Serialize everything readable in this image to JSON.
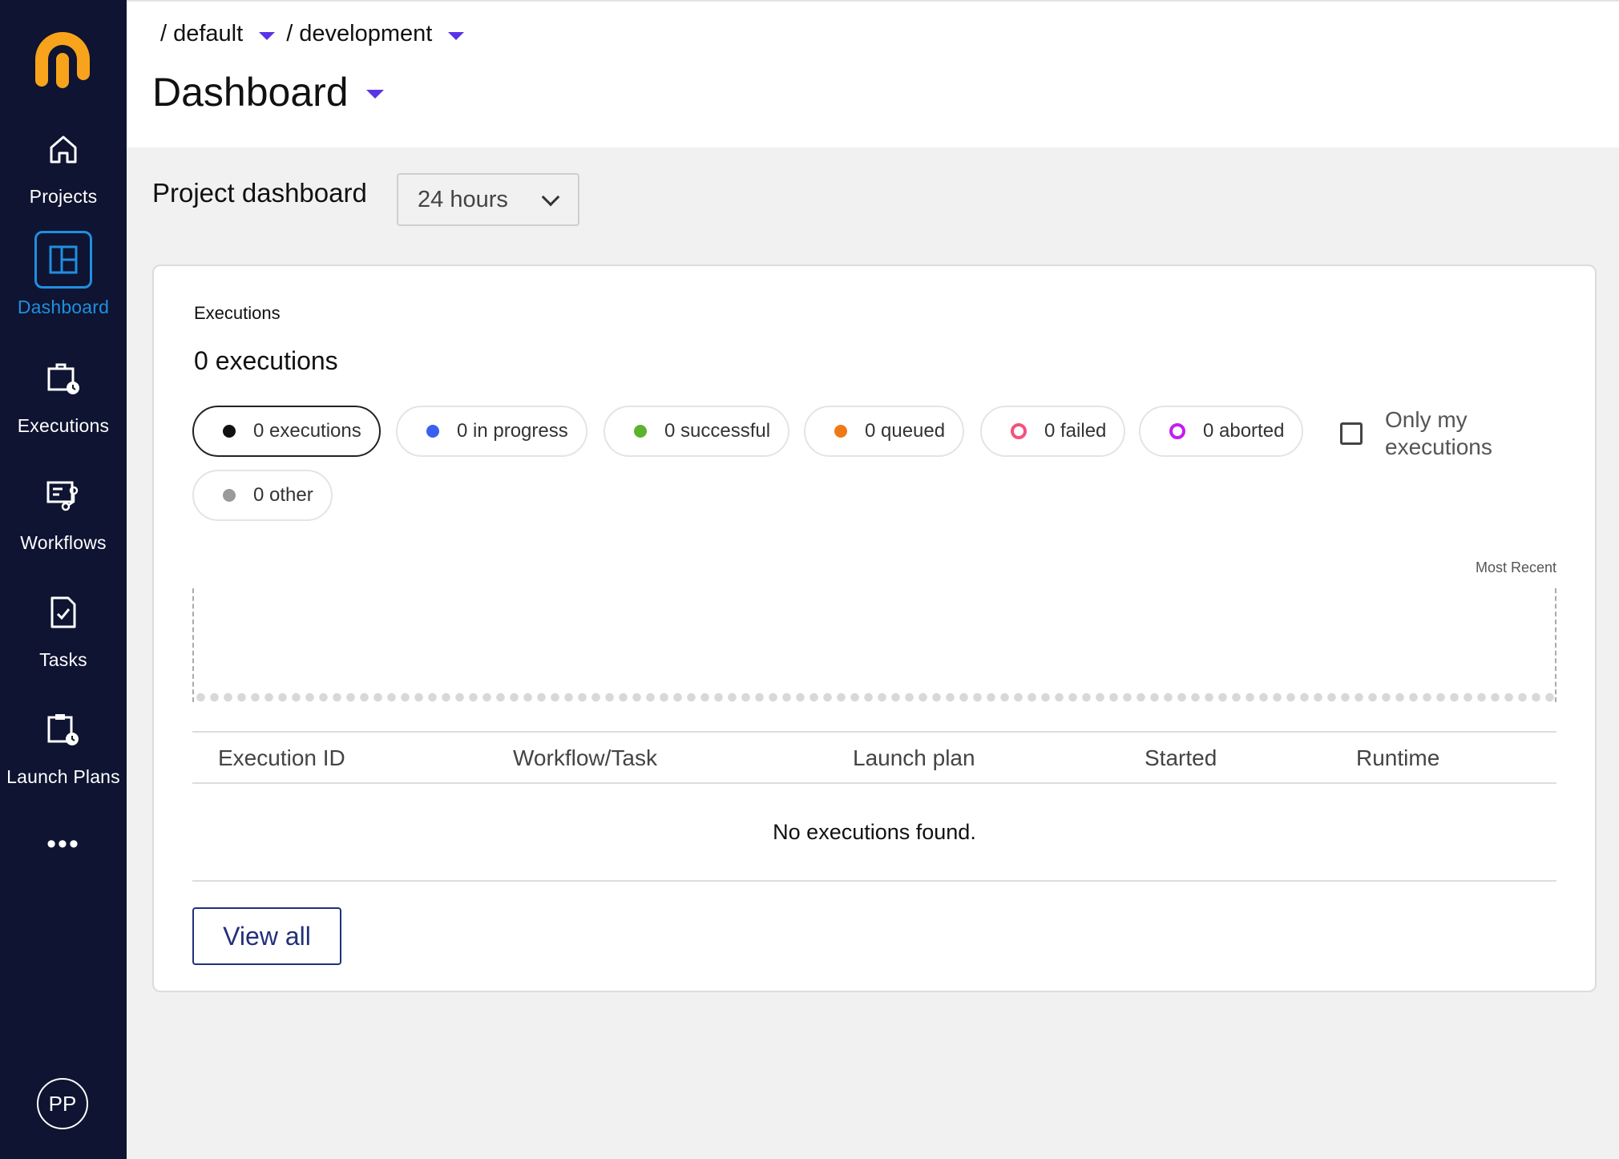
{
  "sidebar": {
    "items": [
      {
        "label": "Projects",
        "icon": "home-icon"
      },
      {
        "label": "Dashboard",
        "icon": "dashboard-icon",
        "active": true
      },
      {
        "label": "Executions",
        "icon": "executions-icon"
      },
      {
        "label": "Workflows",
        "icon": "workflows-icon"
      },
      {
        "label": "Tasks",
        "icon": "tasks-icon"
      },
      {
        "label": "Launch Plans",
        "icon": "launch-plans-icon"
      }
    ],
    "more": "•••",
    "avatar": "PP",
    "active_color": "#1f8fe0",
    "background": "#0e1431",
    "logo_color": "#f8a31c"
  },
  "header": {
    "breadcrumb": [
      "/ default",
      "/ development"
    ],
    "title": "Dashboard",
    "caret_color": "#5a33e6"
  },
  "project": {
    "section_title": "Project dashboard",
    "time_range": "24 hours"
  },
  "executions": {
    "label": "Executions",
    "count_text": "0 executions",
    "filters": [
      {
        "label": "0 executions",
        "color": "#111111",
        "selected": true
      },
      {
        "label": "0 in progress",
        "color": "#3960f2"
      },
      {
        "label": "0 successful",
        "color": "#5cb32c"
      },
      {
        "label": "0 queued",
        "color": "#f07916"
      },
      {
        "label": "0 failed",
        "color": "#f2537b"
      },
      {
        "label": "0 aborted",
        "color": "#c21ef0"
      },
      {
        "label": "0 other",
        "color": "#9a9a9a"
      }
    ],
    "only_mine": "Only my executions",
    "most_recent": "Most Recent",
    "table": {
      "columns": [
        "Execution ID",
        "Workflow/Task",
        "Launch plan",
        "Started",
        "Runtime"
      ],
      "empty": "No executions found."
    },
    "view_all": "View all"
  }
}
